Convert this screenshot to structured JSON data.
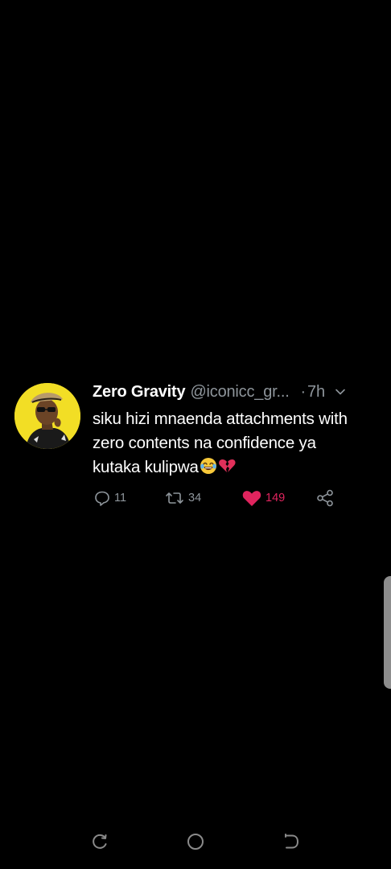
{
  "tweet": {
    "display_name": "Zero Gravity",
    "handle": "@iconicc_gr...",
    "separator": "·",
    "time": "7h",
    "text_lines": [
      "siku hizi mnaenda attachments with",
      "zero contents na confidence  ya",
      "kutaka kulipwa"
    ],
    "emojis": [
      "face-with-tears-of-joy-emoji",
      "broken-heart-emoji"
    ],
    "actions": {
      "replies": "11",
      "retweets": "34",
      "likes": "149"
    },
    "colors": {
      "like": "#e0245e",
      "muted": "#8e959b",
      "avatar_bg": "#f2de25"
    }
  },
  "navbar": {
    "icons": [
      "recent-apps-icon",
      "home-icon",
      "back-icon"
    ]
  }
}
